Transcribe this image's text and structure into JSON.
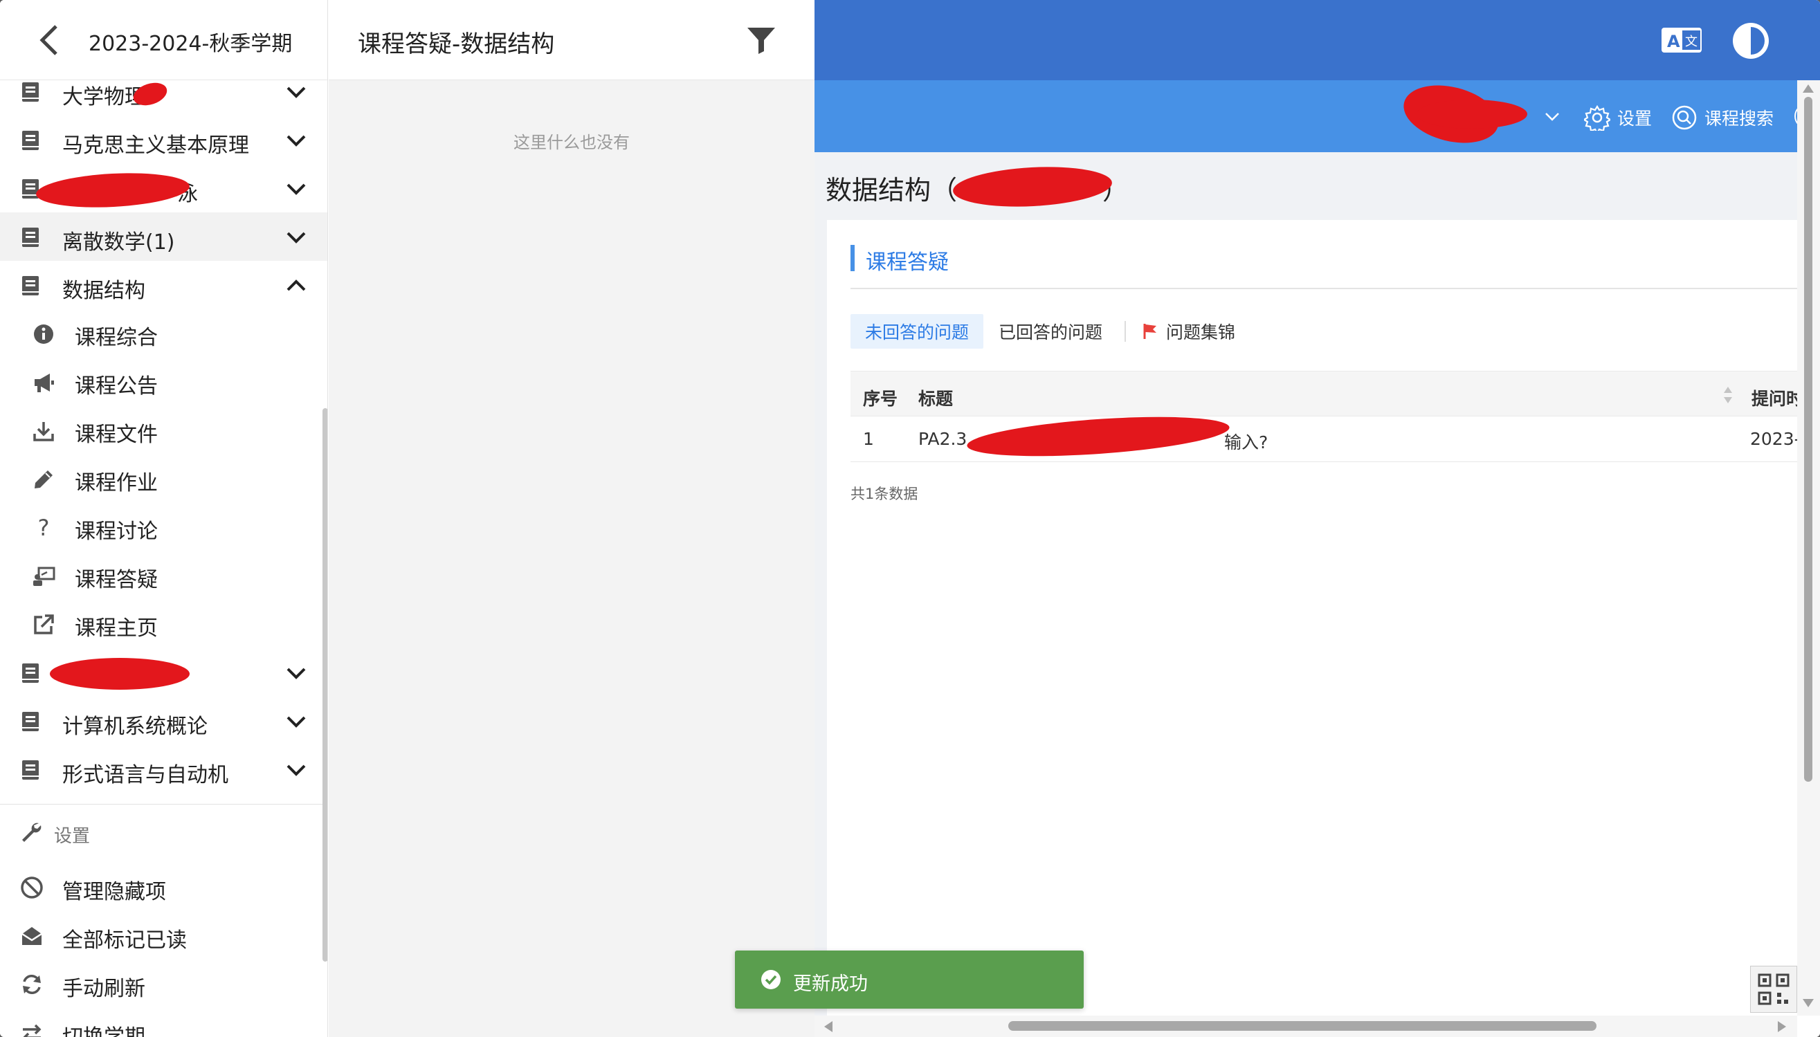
{
  "sidebar": {
    "semester": "2023-2024-秋季学期",
    "courses_top": [
      {
        "label": "大学物理"
      },
      {
        "label": "马克思主义基本原理"
      },
      {
        "label": "泳"
      },
      {
        "label": "离散数学(1)"
      },
      {
        "label": "数据结构"
      }
    ],
    "submenu": [
      {
        "label": "课程综合",
        "icon": "info-icon"
      },
      {
        "label": "课程公告",
        "icon": "megaphone-icon"
      },
      {
        "label": "课程文件",
        "icon": "download-icon"
      },
      {
        "label": "课程作业",
        "icon": "pencil-icon"
      },
      {
        "label": "课程讨论",
        "icon": "question-icon"
      },
      {
        "label": "课程答疑",
        "icon": "presenter-icon"
      },
      {
        "label": "课程主页",
        "icon": "external-link-icon"
      }
    ],
    "courses_bottom": [
      {
        "label": ""
      },
      {
        "label": "计算机系统概论"
      },
      {
        "label": "形式语言与自动机"
      }
    ],
    "settings_heading": "设置",
    "actions": [
      {
        "label": "管理隐藏项",
        "icon": "ban-icon"
      },
      {
        "label": "全部标记已读",
        "icon": "envelope-open-icon"
      },
      {
        "label": "手动刷新",
        "icon": "refresh-icon"
      },
      {
        "label": "切换学期",
        "icon": "switch-icon"
      }
    ]
  },
  "middle": {
    "title": "课程答疑-数据结构",
    "empty_text": "这里什么也没有"
  },
  "web": {
    "nav": {
      "settings": "设置",
      "course_search": "课程搜索"
    },
    "course_heading_prefix": "数据结构（",
    "course_heading_suffix": "）",
    "card_title": "课程答疑",
    "tabs": {
      "unanswered": "未回答的问题",
      "answered": "已回答的问题",
      "collection": "问题集锦"
    },
    "table": {
      "headers": {
        "index": "序号",
        "title": "标题",
        "time": "提问时"
      },
      "rows": [
        {
          "index": "1",
          "title_prefix": "PA2.3",
          "title_suffix": "输入?",
          "time": "2023-"
        }
      ],
      "count": "共1条数据"
    }
  },
  "toast": {
    "text": "更新成功"
  },
  "colors": {
    "top_bar": "#3a72cc",
    "nav_bar": "#4791e6",
    "accent": "#2c7be5",
    "toast": "#5a9e4e",
    "redaction": "#e3171c"
  }
}
